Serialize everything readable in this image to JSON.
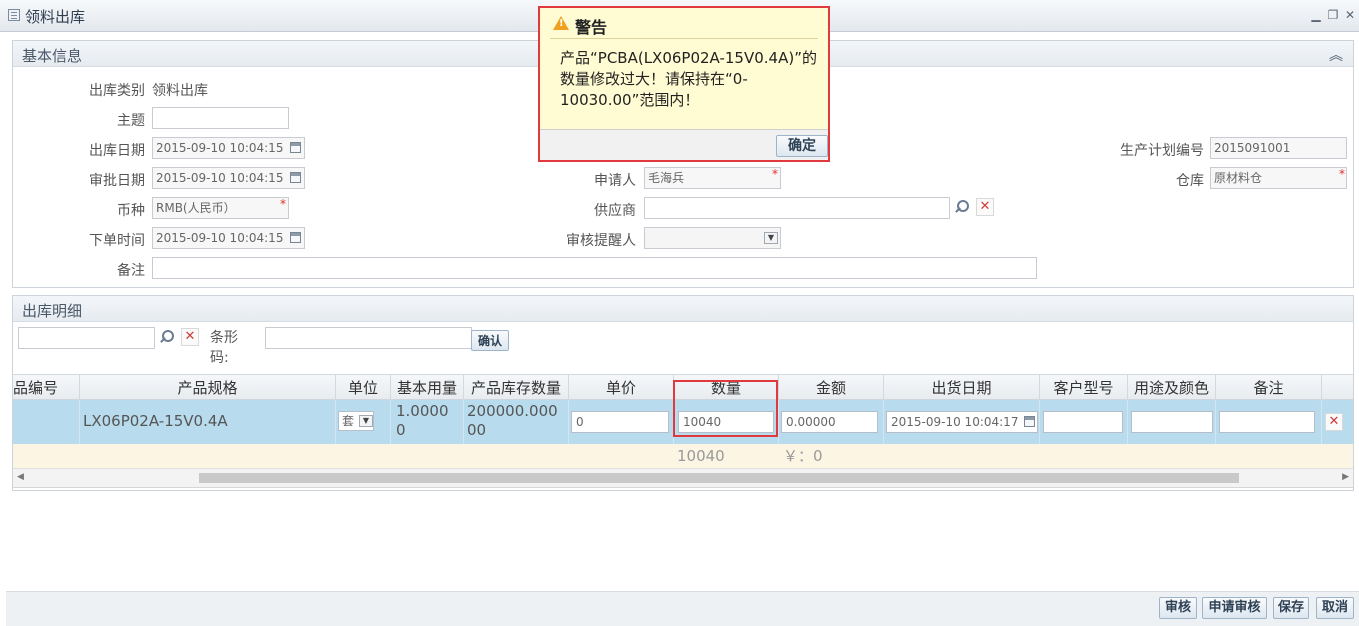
{
  "window": {
    "title": "领料出库"
  },
  "basic_info": {
    "section_title": "基本信息",
    "fields": {
      "out_type": {
        "label": "出库类别",
        "value": "领料出库"
      },
      "subject": {
        "label": "主题",
        "value": ""
      },
      "out_date": {
        "label": "出库日期",
        "value": "2015-09-10 10:04:15"
      },
      "approve_date": {
        "label": "审批日期",
        "value": "2015-09-10 10:04:15"
      },
      "currency": {
        "label": "币种",
        "value": "RMB(人民币）"
      },
      "order_time": {
        "label": "下单时间",
        "value": "2015-09-10 10:04:15"
      },
      "remark": {
        "label": "备注",
        "value": ""
      },
      "applicant": {
        "label": "申请人",
        "value": "毛海兵"
      },
      "supplier": {
        "label": "供应商",
        "value": ""
      },
      "review_reminder": {
        "label": "审核提醒人",
        "value": ""
      },
      "plan_no": {
        "label": "生产计划编号",
        "value": "2015091001"
      },
      "warehouse": {
        "label": "仓库",
        "value": "原材料仓"
      }
    },
    "required_mark": "*"
  },
  "detail": {
    "section_title": "出库明细",
    "search_value": "",
    "barcode_label": "条形码:",
    "barcode_value": "",
    "confirm_label": "确认",
    "columns": [
      "品编号",
      "产品规格",
      "单位",
      "基本用量",
      "产品库存数量",
      "单价",
      "数量",
      "金额",
      "出货日期",
      "客户型号",
      "用途及颜色",
      "备注"
    ],
    "rows": [
      {
        "product_no": "",
        "spec": "LX06P02A-15V0.4A",
        "unit": "套",
        "base_qty": "1.00000",
        "stock_qty": "200000.00000",
        "price": "0",
        "qty": "10040",
        "amount": "0.00000",
        "ship_date": "2015-09-10 10:04:17",
        "customer_model": "",
        "usage_color": "",
        "remark": ""
      }
    ],
    "summary": {
      "qty": "10040",
      "amount": "￥：0"
    }
  },
  "footer": {
    "buttons": [
      "审核",
      "申请审核",
      "保存",
      "取消"
    ]
  },
  "dialog": {
    "title": "警告",
    "message": "产品“PCBA(LX06P02A-15V0.4A)”的数量修改过大！请保持在“0-10030.00”范围内！",
    "ok_label": "确定"
  },
  "colors": {
    "highlight_red": "#e0393e",
    "selected_row": "#b8dcee",
    "summary_row": "#fcf5e3",
    "dialog_bg": "#fffbd2"
  }
}
